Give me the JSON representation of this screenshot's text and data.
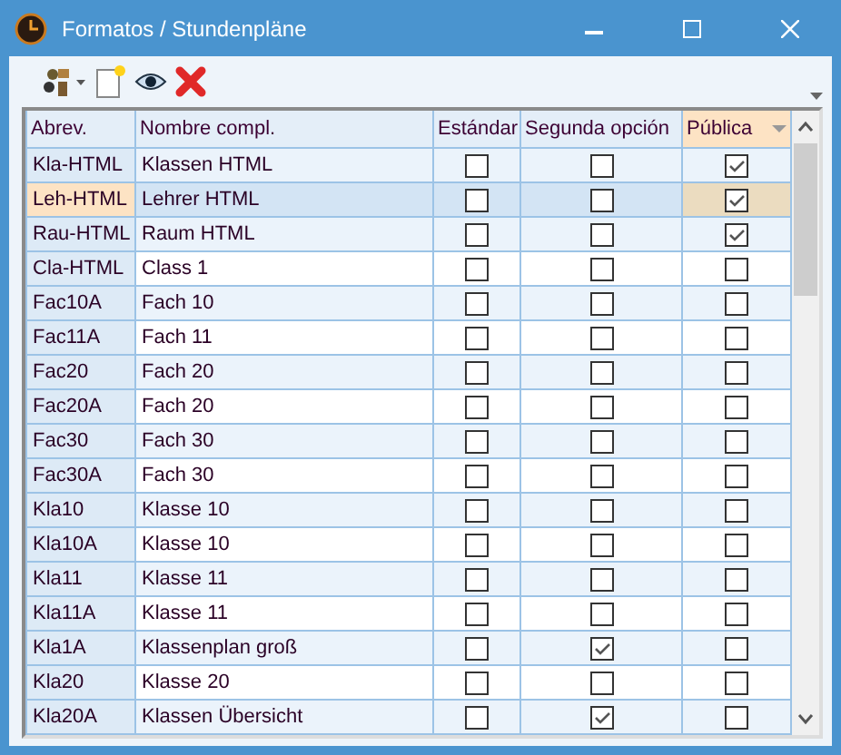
{
  "window": {
    "title": "Formatos / Stundenpläne"
  },
  "table": {
    "columns": [
      {
        "label": "Abrev.",
        "sorted": false
      },
      {
        "label": "Nombre compl.",
        "sorted": false
      },
      {
        "label": "Estándar",
        "sorted": false
      },
      {
        "label": "Segunda opción",
        "sorted": false
      },
      {
        "label": "Pública",
        "sorted": true
      }
    ],
    "rows": [
      {
        "abbrev": "Kla-HTML",
        "name": "Klassen HTML",
        "standard": false,
        "second": false,
        "public": true,
        "selected": false
      },
      {
        "abbrev": "Leh-HTML",
        "name": "Lehrer HTML",
        "standard": false,
        "second": false,
        "public": true,
        "selected": true
      },
      {
        "abbrev": "Rau-HTML",
        "name": "Raum HTML",
        "standard": false,
        "second": false,
        "public": true,
        "selected": false
      },
      {
        "abbrev": "Cla-HTML",
        "name": "Class 1",
        "standard": false,
        "second": false,
        "public": false,
        "selected": false
      },
      {
        "abbrev": "Fac10A",
        "name": "Fach 10",
        "standard": false,
        "second": false,
        "public": false,
        "selected": false
      },
      {
        "abbrev": "Fac11A",
        "name": "Fach 11",
        "standard": false,
        "second": false,
        "public": false,
        "selected": false
      },
      {
        "abbrev": "Fac20",
        "name": "Fach 20",
        "standard": false,
        "second": false,
        "public": false,
        "selected": false
      },
      {
        "abbrev": "Fac20A",
        "name": "Fach 20",
        "standard": false,
        "second": false,
        "public": false,
        "selected": false
      },
      {
        "abbrev": "Fac30",
        "name": "Fach 30",
        "standard": false,
        "second": false,
        "public": false,
        "selected": false
      },
      {
        "abbrev": "Fac30A",
        "name": "Fach 30",
        "standard": false,
        "second": false,
        "public": false,
        "selected": false
      },
      {
        "abbrev": "Kla10",
        "name": "Klasse 10",
        "standard": false,
        "second": false,
        "public": false,
        "selected": false
      },
      {
        "abbrev": "Kla10A",
        "name": "Klasse 10",
        "standard": false,
        "second": false,
        "public": false,
        "selected": false
      },
      {
        "abbrev": "Kla11",
        "name": "Klasse 11",
        "standard": false,
        "second": false,
        "public": false,
        "selected": false
      },
      {
        "abbrev": "Kla11A",
        "name": "Klasse 11",
        "standard": false,
        "second": false,
        "public": false,
        "selected": false
      },
      {
        "abbrev": "Kla1A",
        "name": "Klassenplan groß",
        "standard": false,
        "second": true,
        "public": false,
        "selected": false
      },
      {
        "abbrev": "Kla20",
        "name": "Klasse 20",
        "standard": false,
        "second": false,
        "public": false,
        "selected": false
      },
      {
        "abbrev": "Kla20A",
        "name": "Klassen Übersicht",
        "standard": false,
        "second": true,
        "public": false,
        "selected": false
      }
    ]
  }
}
